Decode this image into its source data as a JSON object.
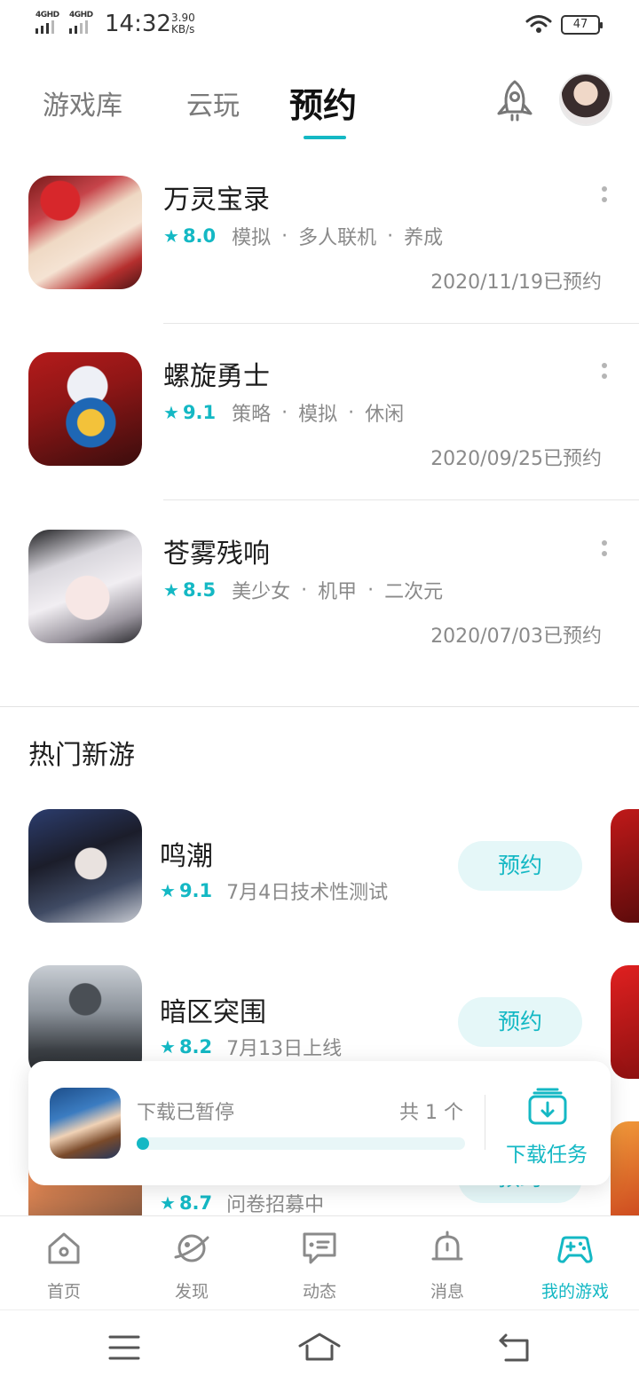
{
  "status_bar": {
    "sim1_label": "4GHD",
    "sim2_label": "4GHD",
    "time": "14:32",
    "speed_value": "3.90",
    "speed_unit": "KB/s",
    "battery": "47"
  },
  "top_tabs": [
    {
      "label": "游戏库",
      "active": false
    },
    {
      "label": "云玩",
      "active": false
    },
    {
      "label": "预约",
      "active": true
    }
  ],
  "reserved_games": [
    {
      "name": "万灵宝录",
      "score": "8.0",
      "tags": [
        "模拟",
        "多人联机",
        "养成"
      ],
      "date": "2020/11/19已预约"
    },
    {
      "name": "螺旋勇士",
      "score": "9.1",
      "tags": [
        "策略",
        "模拟",
        "休闲"
      ],
      "date": "2020/09/25已预约"
    },
    {
      "name": "苍雾残响",
      "score": "8.5",
      "tags": [
        "美少女",
        "机甲",
        "二次元"
      ],
      "date": "2020/07/03已预约"
    }
  ],
  "hot_section": {
    "title": "热门新游",
    "games": [
      {
        "name": "鸣潮",
        "score": "9.1",
        "info": "7月4日技术性测试",
        "button": "预约"
      },
      {
        "name": "暗区突围",
        "score": "8.2",
        "info": "7月13日上线",
        "button": "预约"
      },
      {
        "name": "",
        "score": "8.7",
        "info": "问卷招募中",
        "button": "预约"
      }
    ]
  },
  "download": {
    "status": "下载已暂停",
    "count": "共 1 个",
    "progress": 0.02,
    "task_label": "下载任务"
  },
  "bottom_nav": [
    {
      "label": "首页",
      "icon": "home-icon",
      "active": false
    },
    {
      "label": "发现",
      "icon": "planet-icon",
      "active": false
    },
    {
      "label": "动态",
      "icon": "chat-icon",
      "active": false
    },
    {
      "label": "消息",
      "icon": "bell-icon",
      "active": false
    },
    {
      "label": "我的游戏",
      "icon": "gamepad-icon",
      "active": true
    }
  ],
  "colors": {
    "accent": "#14b8c4",
    "accent_light": "#e5f7f8",
    "text_secondary": "#8a8a8a"
  }
}
